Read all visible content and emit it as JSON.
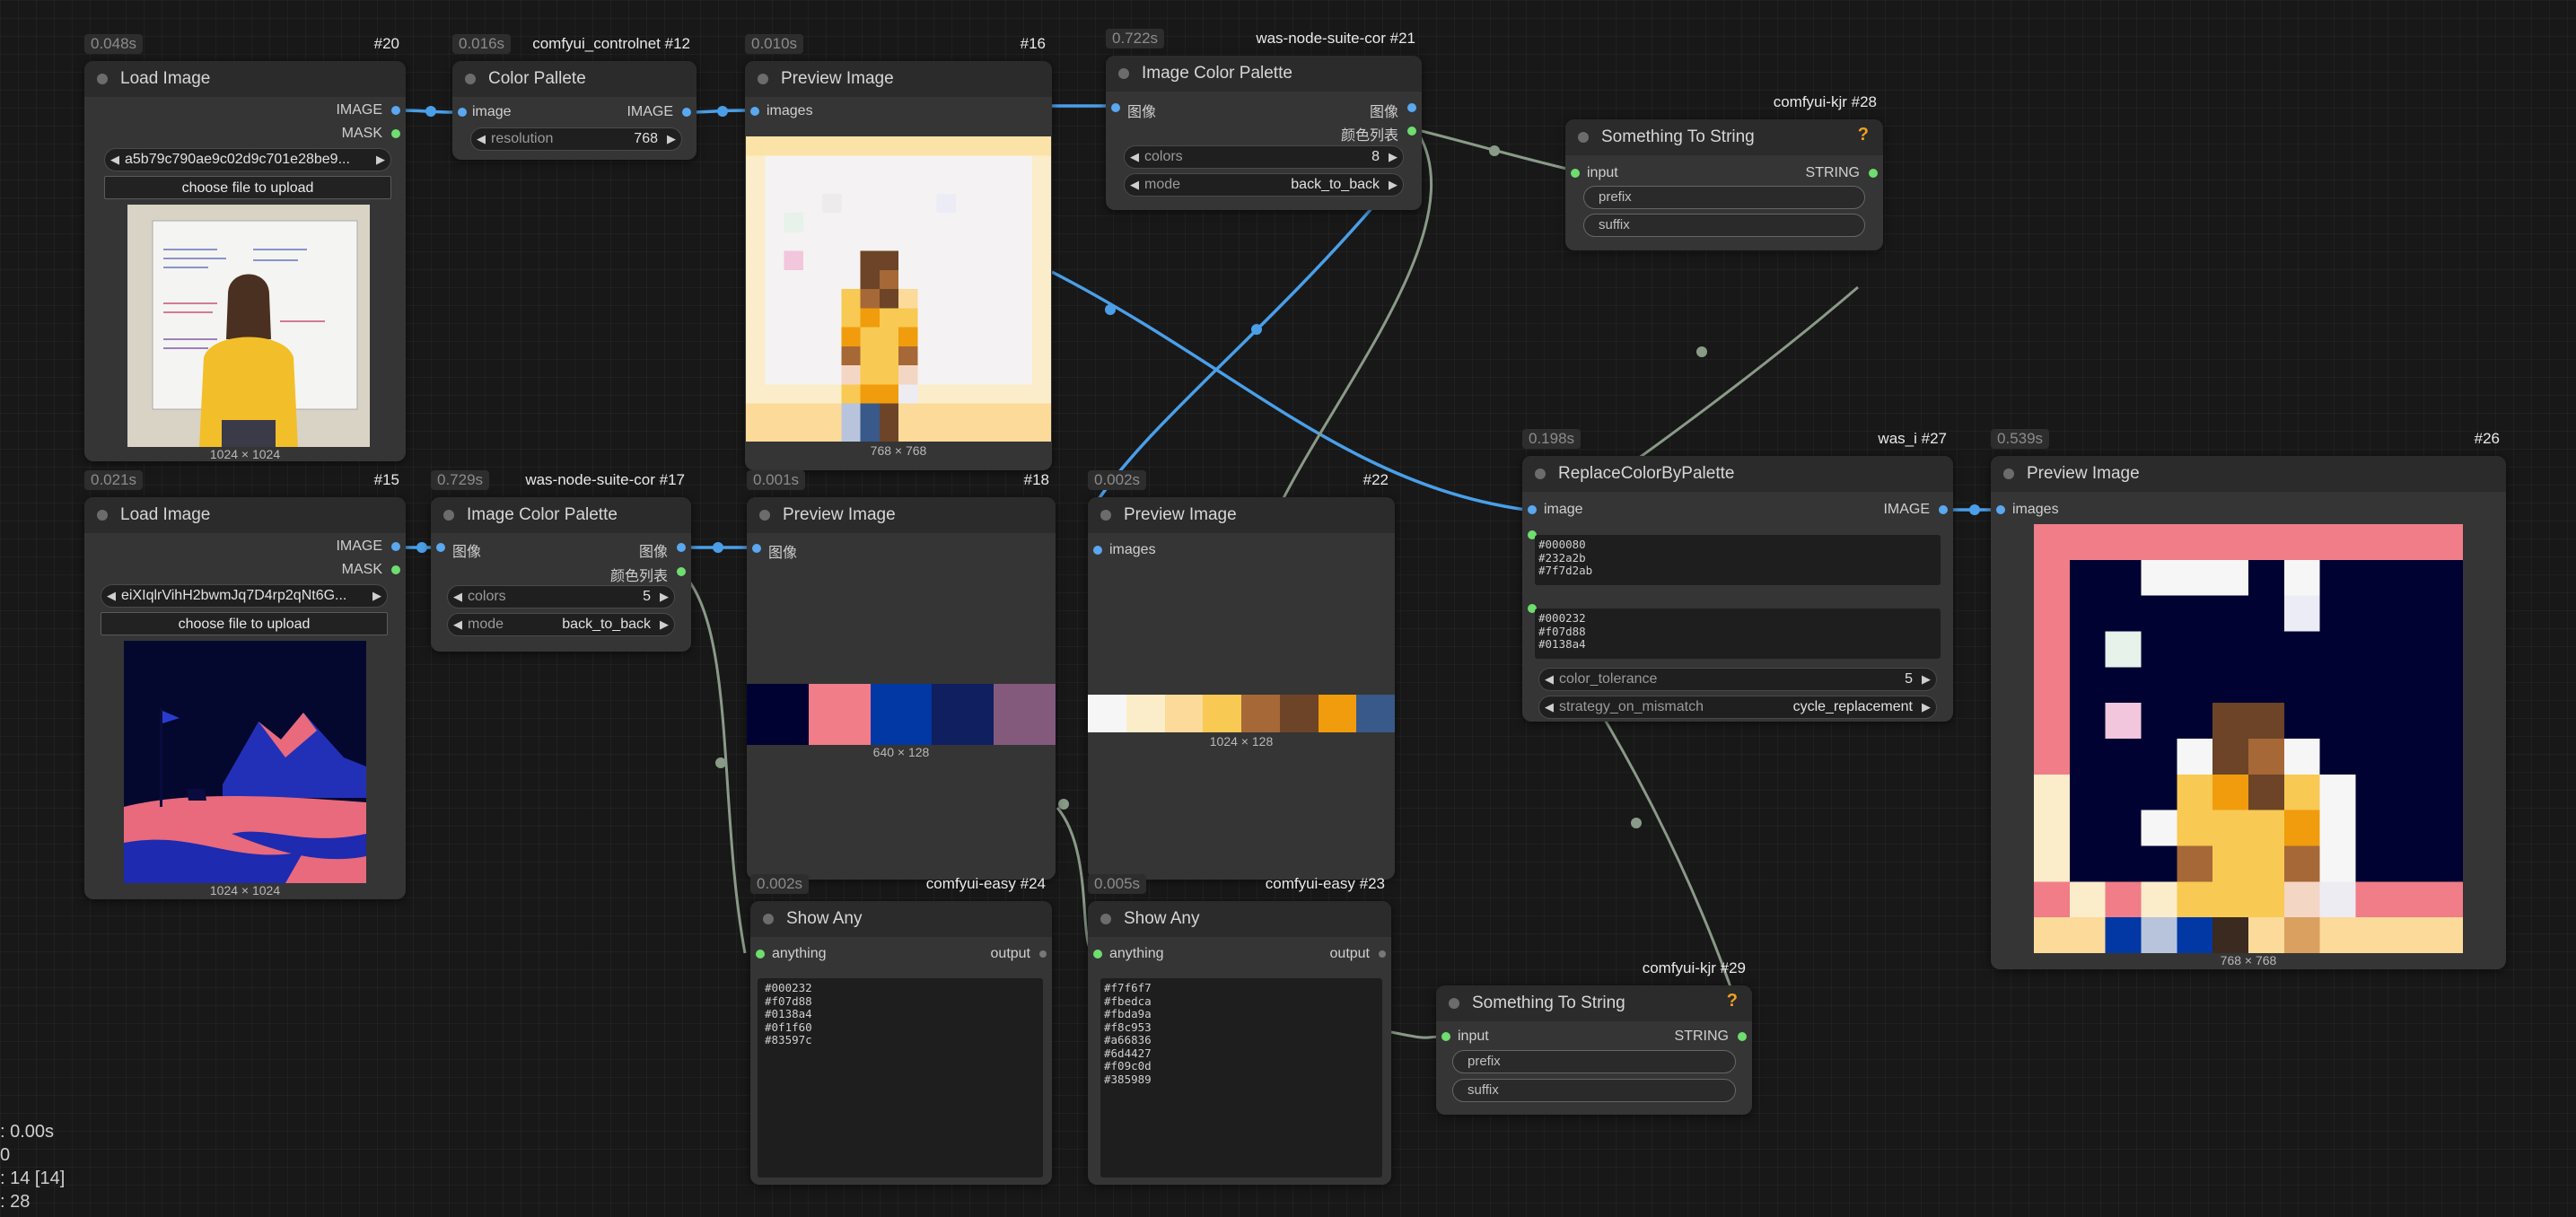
{
  "nodes": {
    "n20": {
      "time": "0.048s",
      "id": "#20",
      "title": "Load Image",
      "out_image": "IMAGE",
      "out_mask": "MASK",
      "file": "a5b79c790ae9c02d9c701e28be9...",
      "upload": "choose file to upload",
      "dims": "1024 × 1024"
    },
    "n12": {
      "time": "0.016s",
      "src": "comfyui_controlnet",
      "id": "#12",
      "title": "Color Pallete",
      "in_image": "image",
      "out_image": "IMAGE",
      "w_label": "resolution",
      "w_value": "768"
    },
    "n16": {
      "time": "0.010s",
      "id": "#16",
      "title": "Preview Image",
      "in_images": "images",
      "dims": "768 × 768"
    },
    "n21": {
      "time": "0.722s",
      "src": "was-node-suite-cor",
      "id": "#21",
      "title": "Image Color Palette",
      "in_image": "图像",
      "out_image": "图像",
      "out_list": "颜色列表",
      "w1_label": "colors",
      "w1_value": "8",
      "w2_label": "mode",
      "w2_value": "back_to_back"
    },
    "n28": {
      "src": "comfyui-kjr",
      "id": "#28",
      "title": "Something To String",
      "in": "input",
      "out": "STRING",
      "prefix": "prefix",
      "suffix": "suffix"
    },
    "n15": {
      "time": "0.021s",
      "id": "#15",
      "title": "Load Image",
      "out_image": "IMAGE",
      "out_mask": "MASK",
      "file": "eiXIqlrVihH2bwmJq7D4rp2qNt6G...",
      "upload": "choose file to upload",
      "dims": "1024 × 1024"
    },
    "n17": {
      "time": "0.729s",
      "src": "was-node-suite-cor",
      "id": "#17",
      "title": "Image Color Palette",
      "in_image": "图像",
      "out_image": "图像",
      "out_list": "颜色列表",
      "w1_label": "colors",
      "w1_value": "5",
      "w2_label": "mode",
      "w2_value": "back_to_back"
    },
    "n18": {
      "time": "0.001s",
      "id": "#18",
      "title": "Preview Image",
      "in_images": "图像",
      "dims": "640 × 128"
    },
    "n22": {
      "time": "0.002s",
      "id": "#22",
      "title": "Preview Image",
      "in_images": "images",
      "dims": "1024 × 128"
    },
    "n27": {
      "time": "0.198s",
      "src": "was_i",
      "id": "#27",
      "title": "ReplaceColorByPalette",
      "in_image": "image",
      "out_image": "IMAGE",
      "text1": "#000080\n#232a2b\n#7f7d2ab",
      "text2": "#000232\n#f07d88\n#0138a4",
      "w1_label": "color_tolerance",
      "w1_value": "5",
      "w2_label": "strategy_on_mismatch",
      "w2_value": "cycle_replacement"
    },
    "n26": {
      "time": "0.539s",
      "id": "#26",
      "title": "Preview Image",
      "in_images": "images",
      "dims": "768 × 768"
    },
    "n24": {
      "time": "0.002s",
      "src": "comfyui-easy",
      "id": "#24",
      "title": "Show Any",
      "in": "anything",
      "out": "output",
      "text": "#000232\n#f07d88\n#0138a4\n#0f1f60\n#83597c"
    },
    "n23": {
      "time": "0.005s",
      "src": "comfyui-easy",
      "id": "#23",
      "title": "Show Any",
      "in": "anything",
      "out": "output",
      "text": "#f7f6f7\n#fbedca\n#fbda9a\n#f8c953\n#a66836\n#6d4427\n#f09c0d\n#385989"
    },
    "n29": {
      "src": "comfyui-kjr",
      "id": "#29",
      "title": "Something To String",
      "in": "input",
      "out": "STRING",
      "prefix": "prefix",
      "suffix": "suffix"
    }
  },
  "palettes": {
    "p18": [
      "#000232",
      "#f07d88",
      "#0138a4",
      "#0f1f60",
      "#83597c"
    ],
    "p22": [
      "#f7f6f7",
      "#fbedca",
      "#fbda9a",
      "#f8c953",
      "#a66836",
      "#6d4427",
      "#f09c0d",
      "#385989"
    ]
  },
  "stats": {
    "line1": ": 0.00s",
    "line2": "0",
    "line3": ": 14 [14]",
    "line4": ": 28"
  },
  "colors": {
    "link_image": "#4a9fe8",
    "link_other": "#8a9a88",
    "background": "#181818",
    "node": "#353535"
  }
}
